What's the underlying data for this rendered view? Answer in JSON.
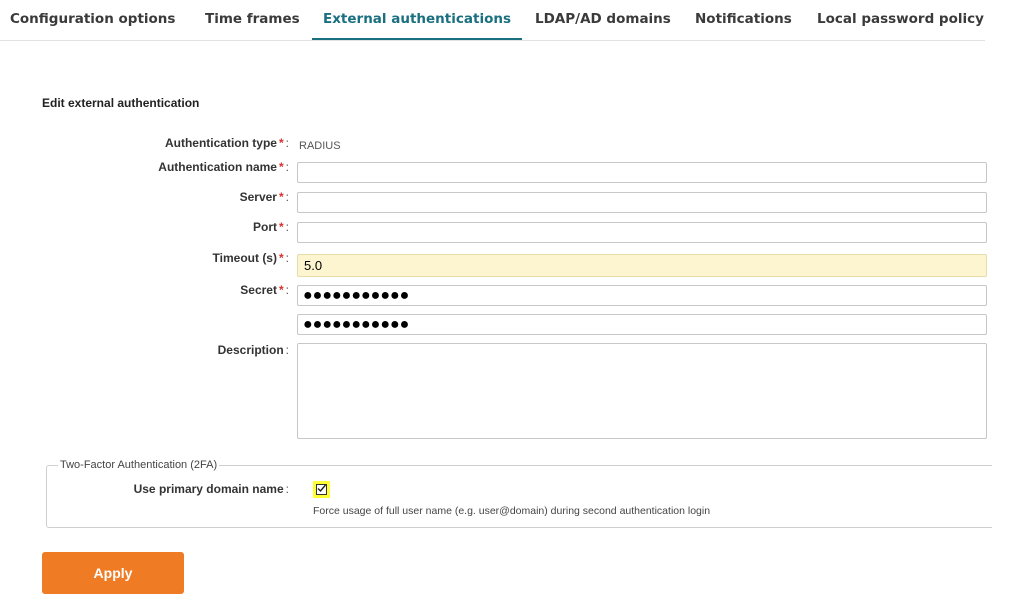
{
  "tabs": [
    {
      "label": "Configuration options"
    },
    {
      "label": "Time frames"
    },
    {
      "label": "External authentications"
    },
    {
      "label": "LDAP/AD domains"
    },
    {
      "label": "Notifications"
    },
    {
      "label": "Local password policy"
    }
  ],
  "form": {
    "title": "Edit external authentication",
    "required_mark": "*",
    "colon": ":",
    "auth_type": {
      "label": "Authentication type",
      "value": "RADIUS"
    },
    "auth_name": {
      "label": "Authentication name",
      "value": ""
    },
    "server": {
      "label": "Server",
      "value": ""
    },
    "port": {
      "label": "Port",
      "value": ""
    },
    "timeout": {
      "label": "Timeout (s)",
      "value": "5.0"
    },
    "secret": {
      "label": "Secret",
      "value": "●●●●●●●●●●●",
      "confirm_value": "●●●●●●●●●●●"
    },
    "description": {
      "label": "Description",
      "value": ""
    }
  },
  "twofa": {
    "legend": "Two-Factor Authentication (2FA)",
    "primary_domain_label": "Use primary domain name",
    "primary_domain_checked": true,
    "hint": "Force usage of full user name (e.g. user@domain) during second authentication login"
  },
  "apply_label": "Apply",
  "colors": {
    "accent": "#1a6f80",
    "apply": "#f07b25",
    "required": "#d9302c",
    "highlight": "#ffff33"
  }
}
